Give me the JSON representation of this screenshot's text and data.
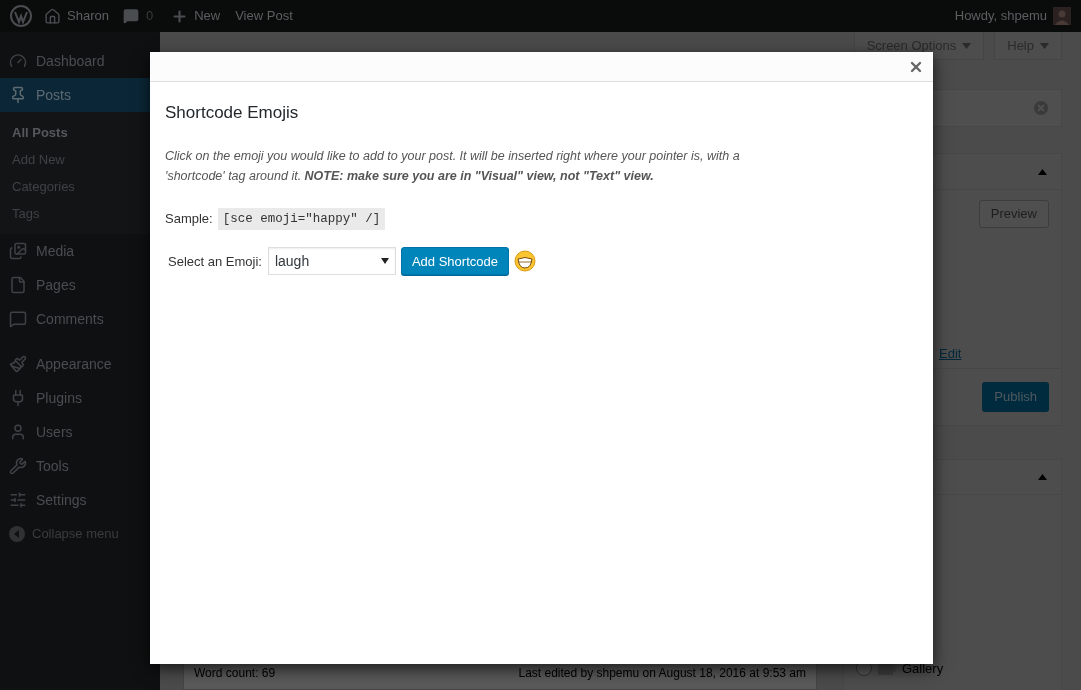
{
  "admin_bar": {
    "site": "Sharon",
    "comments": "0",
    "new": "New",
    "view": "View Post",
    "greeting": "Howdy, shpemu"
  },
  "sidebar": {
    "items": [
      {
        "label": "Dashboard",
        "selected": false
      },
      {
        "label": "Posts",
        "selected": true,
        "children": [
          {
            "label": "All Posts",
            "selected": true
          },
          {
            "label": "Add New",
            "selected": false
          },
          {
            "label": "Categories",
            "selected": false
          },
          {
            "label": "Tags",
            "selected": false
          }
        ]
      },
      {
        "label": "Media",
        "selected": false
      },
      {
        "label": "Pages",
        "selected": false
      },
      {
        "label": "Comments",
        "selected": false
      },
      {
        "label": "Appearance",
        "selected": false
      },
      {
        "label": "Plugins",
        "selected": false
      },
      {
        "label": "Users",
        "selected": false
      },
      {
        "label": "Tools",
        "selected": false
      },
      {
        "label": "Settings",
        "selected": false
      }
    ],
    "collapse": "Collapse menu"
  },
  "screen_options": "Screen Options",
  "help": "Help",
  "publish_box": {
    "preview": "Preview",
    "edit_link": "Edit",
    "publish": "Publish"
  },
  "format_box": {
    "option": "Gallery",
    "selected": false
  },
  "status_bar": {
    "word_count": "Word count: 69",
    "last_edited": "Last edited by shpemu on August 18, 2016 at 9:53 am"
  },
  "modal": {
    "title": "Shortcode Emojis",
    "description": "Click on the emoji you would like to add to your post. It will be inserted right where your pointer is, with a 'shortcode' tag around it. **NOTE: make sure you are in \"Visual\" view, not \"Text\" view.**",
    "sample_label": "Sample:",
    "sample_code": "[sce emoji=\"happy\" /]",
    "select_label": "Select an Emoji:",
    "select_value": "laugh",
    "button": "Add Shortcode"
  }
}
